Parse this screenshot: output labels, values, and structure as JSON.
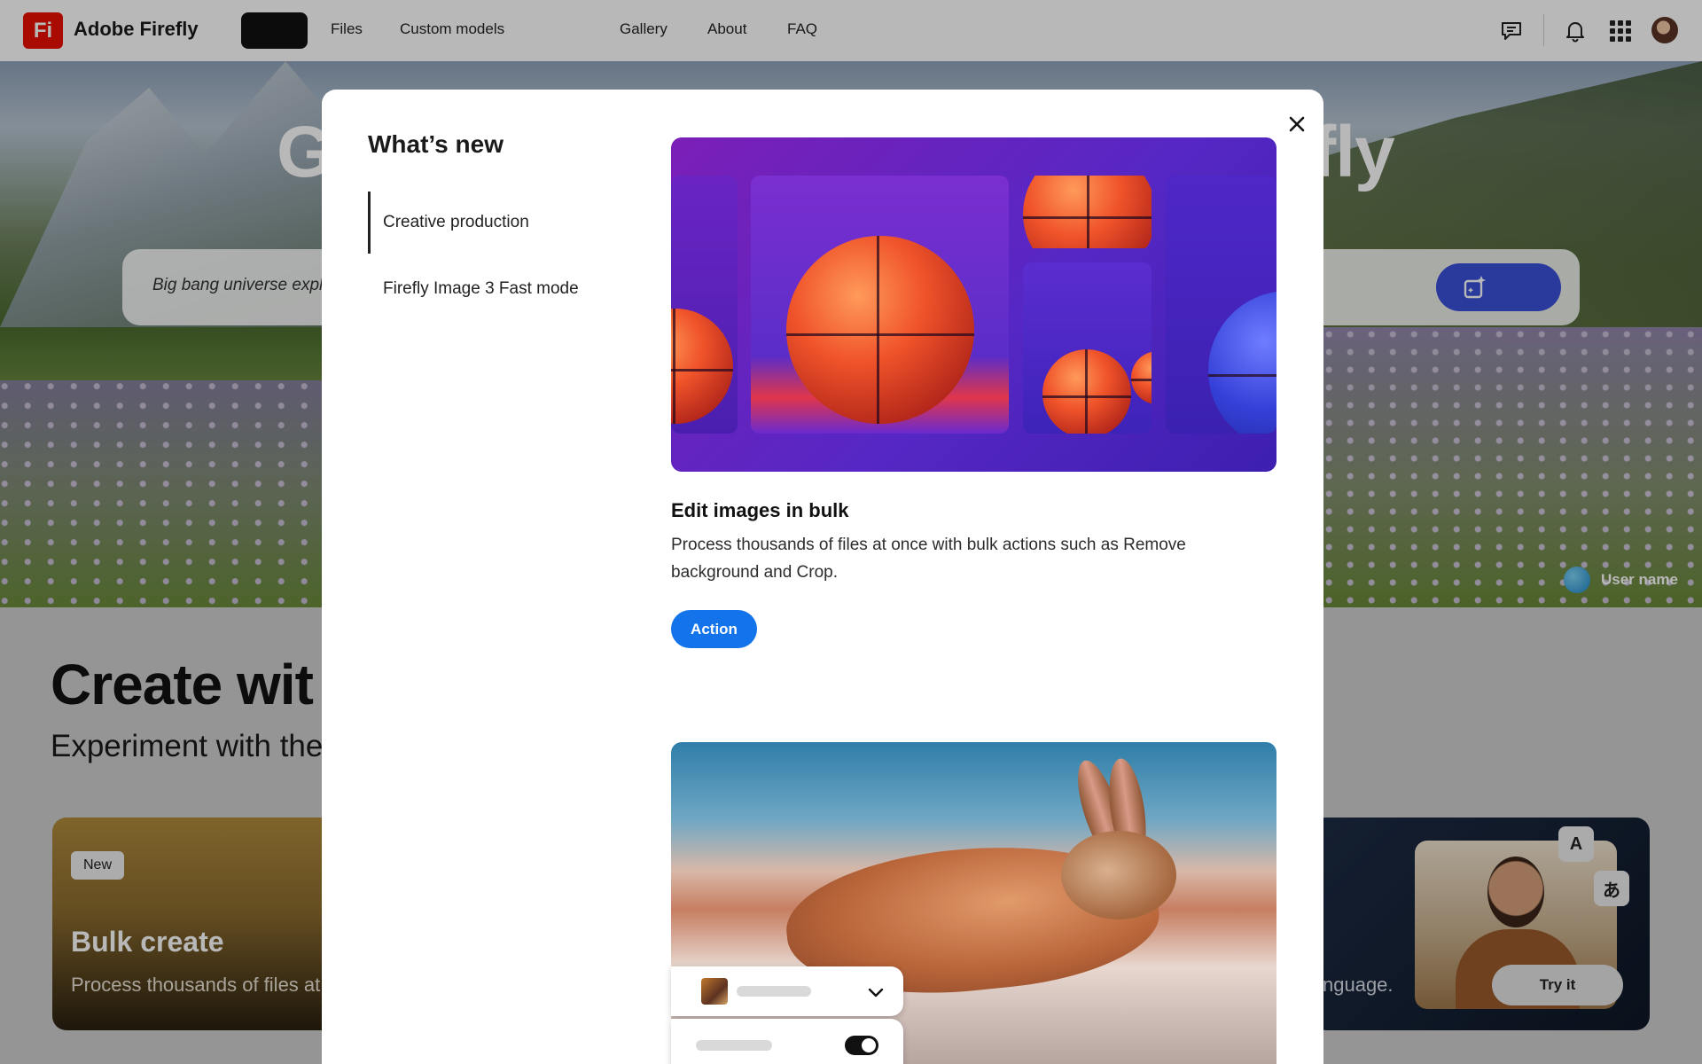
{
  "app": {
    "brand": "Adobe Firefly",
    "logo_text": "Fi"
  },
  "nav": {
    "links_left": [
      "Files",
      "Custom models"
    ],
    "links_center": [
      "Gallery",
      "About",
      "FAQ"
    ]
  },
  "icons": [
    "message-icon",
    "bell-icon",
    "apps-grid-icon",
    "sparkle-generate-icon",
    "close-icon",
    "chevron-down-icon"
  ],
  "hero": {
    "title_left_fragment": "G",
    "title_right_fragment": "fly",
    "prompt_placeholder": "Big bang universe expl",
    "user_name": "User name"
  },
  "section": {
    "title": "Create wit",
    "subtitle": "Experiment with the"
  },
  "cards": {
    "left": {
      "badge": "New",
      "title": "Bulk create",
      "description": "Process thousands of files at c"
    },
    "right": {
      "description": "nguage.",
      "glyph_a": "A",
      "glyph_jp": "あ",
      "button": "Try it"
    }
  },
  "modal": {
    "title": "What’s new",
    "menu": [
      {
        "label": "Creative production",
        "active": true
      },
      {
        "label": "Firefly Image 3 Fast mode",
        "active": false
      }
    ],
    "feature": {
      "title": "Edit images in bulk",
      "description": "Process thousands of files at once with bulk actions such as Remove background and Crop.",
      "action_label": "Action"
    }
  },
  "colors": {
    "accent_blue": "#1273eb",
    "generate_button": "#3a50d9",
    "brand_red": "#eb1000"
  }
}
